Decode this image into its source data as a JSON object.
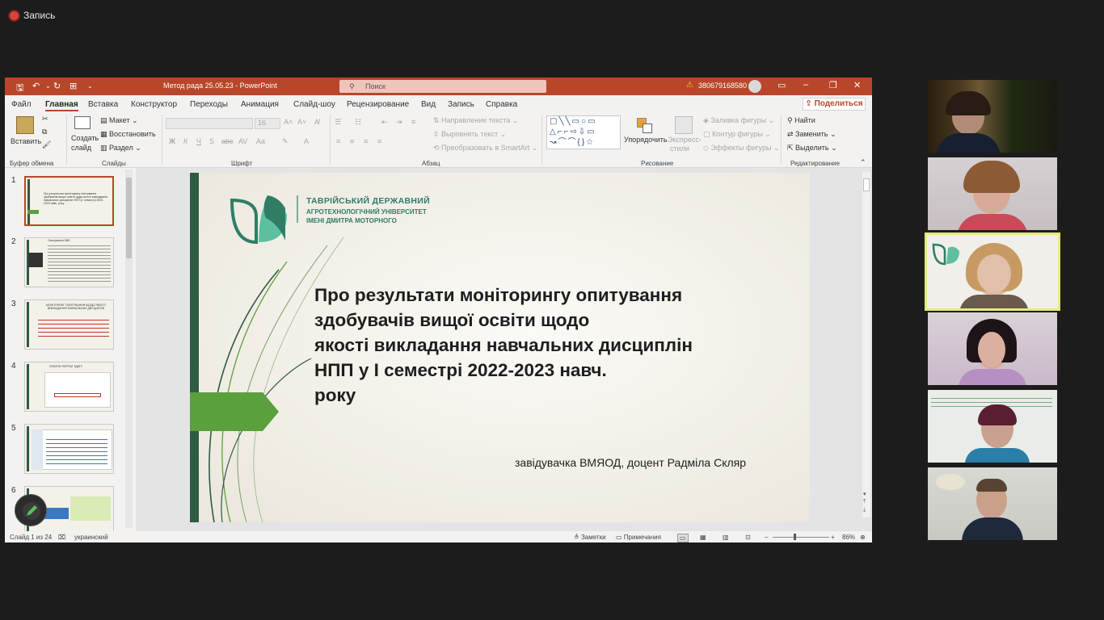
{
  "recording": {
    "label": "Запись"
  },
  "window": {
    "title": "Метод рада 25.05.23  -  PowerPoint",
    "search_placeholder": "Поиск",
    "account": "380679168580"
  },
  "tabs": [
    "Файл",
    "Главная",
    "Вставка",
    "Конструктор",
    "Переходы",
    "Анимация",
    "Слайд-шоу",
    "Рецензирование",
    "Вид",
    "Запись",
    "Справка"
  ],
  "share_label": "Поделиться",
  "ribbon": {
    "clipboard": {
      "paste": "Вставить",
      "group": "Буфер обмена"
    },
    "slides": {
      "create": "Создать",
      "slide": "слайд",
      "layout": "Макет",
      "restore": "Восстановить",
      "section": "Раздел",
      "group": "Слайды"
    },
    "font": {
      "size": "16",
      "group": "Шрифт"
    },
    "paragraph": {
      "text_direction": "Направление текста",
      "align_text": "Выровнять текст",
      "smartart": "Преобразовать в SmartArt",
      "group": "Абзац"
    },
    "drawing": {
      "arrange": "Упорядочить",
      "express": "Экспресс-",
      "styles": "стили",
      "fill": "Заливка фигуры",
      "outline": "Контур фигуры",
      "effects": "Эффекты фигуры",
      "group": "Рисование"
    },
    "editing": {
      "find": "Найти",
      "replace": "Заменить",
      "select": "Выделить",
      "group": "Редактирование"
    }
  },
  "thumbnails": [
    "1",
    "2",
    "3",
    "4",
    "5",
    "6"
  ],
  "slide": {
    "uni_line1": "ТАВРІЙСЬКИЙ ДЕРЖАВНИЙ",
    "uni_line2": "АГРОТЕХНОЛОГІЧНИЙ УНІВЕРСИТЕТ",
    "uni_line3": "ІМЕНІ ДМИТРА МОТОРНОГО",
    "title_lines": [
      "Про результати моніторингу опитування",
      "здобувачів вищої освіти щодо",
      "якості викладання навчальних дисциплін",
      "НПП у І семестрі 2022-2023 навч.",
      "року"
    ],
    "subtitle": "завідувачка ВМЯОД, доцент Радміла Скляр",
    "thumb_titles": [
      "Про результати моніторингу опитування здобувачів вищої освіти щодо якості викладання навчальних дисциплін НПП у І семестрі 2022-2023 навч. року",
      "Опитування ЗВО",
      "МОНІТОРИНГ ОПИТУВАННЯ ЩОДО ЯКОСТІ ВИКЛАДАННЯ НАВЧАЛЬНИХ ДИСЦИПЛІН",
      "ОСВІТНІ ПОРТАЛ ТДАТУ"
    ]
  },
  "status": {
    "slide_counter": "Слайд 1 из 24",
    "language": "украинский",
    "notes": "Заметки",
    "comments": "Примечания",
    "zoom": "86%"
  },
  "colors": {
    "accent": "#b7472a",
    "green": "#5aa03c",
    "dark_green": "#2f5b43"
  }
}
